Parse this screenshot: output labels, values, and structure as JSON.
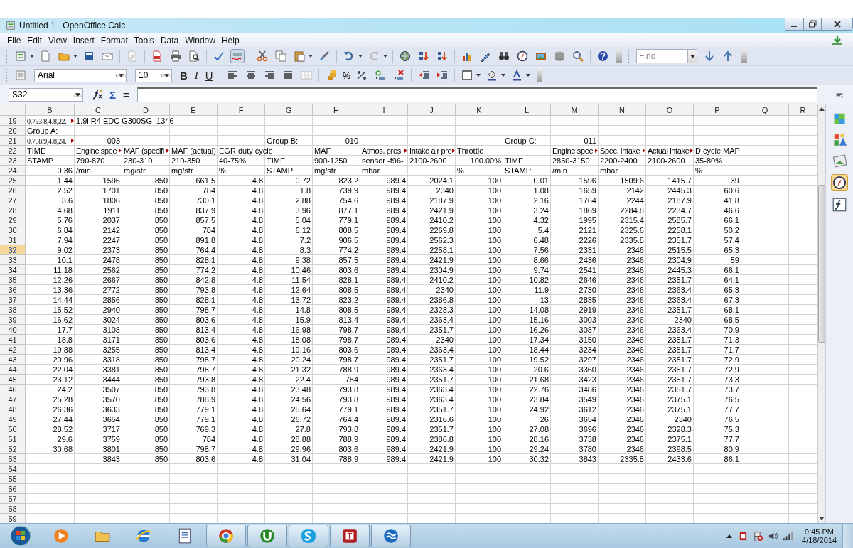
{
  "window": {
    "title": "Untitled 1 - OpenOffice Calc"
  },
  "menu": [
    "File",
    "Edit",
    "View",
    "Insert",
    "Format",
    "Tools",
    "Data",
    "Window",
    "Help"
  ],
  "find": {
    "placeholder": "Find"
  },
  "formatting": {
    "font": "Arial",
    "size": "10",
    "style_buttons": [
      "B",
      "I",
      "U"
    ],
    "percent": "%"
  },
  "formula_bar": {
    "cell_reference": "S32",
    "buttons": [
      "Σ",
      "="
    ]
  },
  "sheet": {
    "columns": [
      "B",
      "C",
      "D",
      "E",
      "F",
      "G",
      "H",
      "I",
      "J",
      "K",
      "L",
      "M",
      "N",
      "O",
      "P",
      "Q",
      "R"
    ],
    "rows": [
      {
        "number": "19",
        "selected": false,
        "cells": [
          {
            "text": "0,793.8,4.8,22.",
            "clipped": true
          },
          "1.9l R4 EDC G300SG  1346",
          null,
          null,
          null,
          null,
          null,
          null,
          null,
          null,
          null,
          null,
          null,
          null,
          null
        ]
      },
      {
        "number": "20",
        "selected": false,
        "cells": [
          "Group A:",
          null,
          null,
          null,
          null,
          null,
          null,
          null,
          null,
          null,
          null,
          null,
          null,
          null,
          null
        ]
      },
      {
        "number": "21",
        "selected": false,
        "cells": [
          {
            "text": "0,788.9,4.8,24.",
            "clipped": true
          },
          "003",
          null,
          null,
          null,
          "Group B:",
          "010",
          null,
          null,
          null,
          "Group C:",
          "011",
          null,
          null,
          null
        ]
      },
      {
        "number": "22",
        "selected": false,
        "cells": [
          "TIME",
          {
            "text": "Engine spee",
            "clipped": true
          },
          {
            "text": "MAF (specifi",
            "clipped": true
          },
          "MAF (actual)",
          "EGR duty cycle",
          null,
          "MAF",
          {
            "text": "Atmos. pres",
            "clipped": true
          },
          {
            "text": "Intake air pre",
            "clipped": true
          },
          "Throttle",
          null,
          {
            "text": "Engine spee",
            "clipped": true
          },
          {
            "text": "Spec. intake",
            "clipped": true
          },
          {
            "text": "Actual intake",
            "clipped": true
          },
          "D.cycle MAP"
        ]
      },
      {
        "number": "23",
        "selected": false,
        "cells": [
          "STAMP",
          "790-870",
          "230-310",
          "210-350",
          "40-75%",
          "TIME",
          "900-1250",
          "sensor -f96-",
          "2100-2600",
          "100.00%",
          "TIME",
          "2850-3150",
          "2200-2400",
          "2100-2600",
          "35-80%"
        ]
      },
      {
        "number": "24",
        "selected": false,
        "cells": [
          "0.36",
          "/min",
          "mg/str",
          "mg/str",
          "%",
          "STAMP",
          "mg/str",
          "mbar",
          null,
          "%",
          "STAMP",
          "/min",
          "mbar",
          null,
          "%"
        ]
      },
      {
        "number": "25",
        "selected": false,
        "cells": [
          "1.44",
          "1596",
          "850",
          "661.5",
          "4.8",
          "0.72",
          "823.2",
          "989.4",
          "2024.1",
          "100",
          "0.01",
          "1596",
          "1509.6",
          "1415.7",
          "39"
        ]
      },
      {
        "number": "26",
        "selected": false,
        "cells": [
          "2.52",
          "1701",
          "850",
          "784",
          "4.8",
          "1.8",
          "739.9",
          "989.4",
          "2340",
          "100",
          "1.08",
          "1659",
          "2142",
          "2445.3",
          "60.6"
        ]
      },
      {
        "number": "27",
        "selected": false,
        "cells": [
          "3.6",
          "1806",
          "850",
          "730.1",
          "4.8",
          "2.88",
          "754.6",
          "989.4",
          "2187.9",
          "100",
          "2.16",
          "1764",
          "2244",
          "2187.9",
          "41.8"
        ]
      },
      {
        "number": "28",
        "selected": false,
        "cells": [
          "4.68",
          "1911",
          "850",
          "837.9",
          "4.8",
          "3.96",
          "877.1",
          "989.4",
          "2421.9",
          "100",
          "3.24",
          "1869",
          "2284.8",
          "2234.7",
          "46.6"
        ]
      },
      {
        "number": "29",
        "selected": false,
        "cells": [
          "5.76",
          "2037",
          "850",
          "857.5",
          "4.8",
          "5.04",
          "779.1",
          "989.4",
          "2410.2",
          "100",
          "4.32",
          "1995",
          "2315.4",
          "2585.7",
          "66.1"
        ]
      },
      {
        "number": "30",
        "selected": false,
        "cells": [
          "6.84",
          "2142",
          "850",
          "784",
          "4.8",
          "6.12",
          "808.5",
          "989.4",
          "2269.8",
          "100",
          "5.4",
          "2121",
          "2325.6",
          "2258.1",
          "50.2"
        ]
      },
      {
        "number": "31",
        "selected": false,
        "cells": [
          "7.94",
          "2247",
          "850",
          "891.8",
          "4.8",
          "7.2",
          "906.5",
          "989.4",
          "2562.3",
          "100",
          "6.48",
          "2226",
          "2335.8",
          "2351.7",
          "57.4"
        ]
      },
      {
        "number": "32",
        "selected": true,
        "cells": [
          "9.02",
          "2373",
          "850",
          "764.4",
          "4.8",
          "8.3",
          "774.2",
          "989.4",
          "2258.1",
          "100",
          "7.56",
          "2331",
          "2346",
          "2515.5",
          "65.3"
        ]
      },
      {
        "number": "33",
        "selected": false,
        "cells": [
          "10.1",
          "2478",
          "850",
          "828.1",
          "4.8",
          "9.38",
          "857.5",
          "989.4",
          "2421.9",
          "100",
          "8.66",
          "2436",
          "2346",
          "2304.9",
          "59"
        ]
      },
      {
        "number": "34",
        "selected": false,
        "cells": [
          "11.18",
          "2562",
          "850",
          "774.2",
          "4.8",
          "10.46",
          "803.6",
          "989.4",
          "2304.9",
          "100",
          "9.74",
          "2541",
          "2346",
          "2445.3",
          "66.1"
        ]
      },
      {
        "number": "35",
        "selected": false,
        "cells": [
          "12.26",
          "2667",
          "850",
          "842.8",
          "4.8",
          "11.54",
          "828.1",
          "989.4",
          "2410.2",
          "100",
          "10.82",
          "2646",
          "2346",
          "2351.7",
          "64.1"
        ]
      },
      {
        "number": "36",
        "selected": false,
        "cells": [
          "13.36",
          "2772",
          "850",
          "793.8",
          "4.8",
          "12.64",
          "808.5",
          "989.4",
          "2340",
          "100",
          "11.9",
          "2730",
          "2346",
          "2363.4",
          "65.3"
        ]
      },
      {
        "number": "37",
        "selected": false,
        "cells": [
          "14.44",
          "2856",
          "850",
          "828.1",
          "4.8",
          "13.72",
          "823.2",
          "989.4",
          "2386.8",
          "100",
          "13",
          "2835",
          "2346",
          "2363.4",
          "67.3"
        ]
      },
      {
        "number": "38",
        "selected": false,
        "cells": [
          "15.52",
          "2940",
          "850",
          "798.7",
          "4.8",
          "14.8",
          "808.5",
          "989.4",
          "2328.3",
          "100",
          "14.08",
          "2919",
          "2346",
          "2351.7",
          "68.1"
        ]
      },
      {
        "number": "39",
        "selected": false,
        "cells": [
          "16.62",
          "3024",
          "850",
          "803.6",
          "4.8",
          "15.9",
          "813.4",
          "989.4",
          "2363.4",
          "100",
          "15.16",
          "3003",
          "2346",
          "2340",
          "68.5"
        ]
      },
      {
        "number": "40",
        "selected": false,
        "cells": [
          "17.7",
          "3108",
          "850",
          "813.4",
          "4.8",
          "16.98",
          "798.7",
          "989.4",
          "2351.7",
          "100",
          "16.26",
          "3087",
          "2346",
          "2363.4",
          "70.9"
        ]
      },
      {
        "number": "41",
        "selected": false,
        "cells": [
          "18.8",
          "3171",
          "850",
          "803.6",
          "4.8",
          "18.08",
          "798.7",
          "989.4",
          "2340",
          "100",
          "17.34",
          "3150",
          "2346",
          "2351.7",
          "71.3"
        ]
      },
      {
        "number": "42",
        "selected": false,
        "cells": [
          "19.88",
          "3255",
          "850",
          "813.4",
          "4.8",
          "19.16",
          "803.6",
          "989.4",
          "2363.4",
          "100",
          "18.44",
          "3234",
          "2346",
          "2351.7",
          "71.7"
        ]
      },
      {
        "number": "43",
        "selected": false,
        "cells": [
          "20.96",
          "3318",
          "850",
          "798.7",
          "4.8",
          "20.24",
          "798.7",
          "989.4",
          "2351.7",
          "100",
          "19.52",
          "3297",
          "2346",
          "2351.7",
          "72.9"
        ]
      },
      {
        "number": "44",
        "selected": false,
        "cells": [
          "22.04",
          "3381",
          "850",
          "798.7",
          "4.8",
          "21.32",
          "788.9",
          "989.4",
          "2363.4",
          "100",
          "20.6",
          "3360",
          "2346",
          "2351.7",
          "72.9"
        ]
      },
      {
        "number": "45",
        "selected": false,
        "cells": [
          "23.12",
          "3444",
          "850",
          "793.8",
          "4.8",
          "22.4",
          "784",
          "989.4",
          "2351.7",
          "100",
          "21.68",
          "3423",
          "2346",
          "2351.7",
          "73.3"
        ]
      },
      {
        "number": "46",
        "selected": false,
        "cells": [
          "24.2",
          "3507",
          "850",
          "793.8",
          "4.8",
          "23.48",
          "793.8",
          "989.4",
          "2363.4",
          "100",
          "22.76",
          "3486",
          "2346",
          "2351.7",
          "73.7"
        ]
      },
      {
        "number": "47",
        "selected": false,
        "cells": [
          "25.28",
          "3570",
          "850",
          "788.9",
          "4.8",
          "24.56",
          "793.8",
          "989.4",
          "2363.4",
          "100",
          "23.84",
          "3549",
          "2346",
          "2375.1",
          "76.5"
        ]
      },
      {
        "number": "48",
        "selected": false,
        "cells": [
          "26.36",
          "3633",
          "850",
          "779.1",
          "4.8",
          "25.64",
          "779.1",
          "989.4",
          "2351.7",
          "100",
          "24.92",
          "3612",
          "2346",
          "2375.1",
          "77.7"
        ]
      },
      {
        "number": "49",
        "selected": false,
        "cells": [
          "27.44",
          "3654",
          "850",
          "779.1",
          "4.8",
          "26.72",
          "764.4",
          "989.4",
          "2316.6",
          "100",
          "26",
          "3654",
          "2346",
          "2340",
          "76.5"
        ]
      },
      {
        "number": "50",
        "selected": false,
        "cells": [
          "28.52",
          "3717",
          "850",
          "769.3",
          "4.8",
          "27.8",
          "793.8",
          "989.4",
          "2351.7",
          "100",
          "27.08",
          "3696",
          "2346",
          "2328.3",
          "75.3"
        ]
      },
      {
        "number": "51",
        "selected": false,
        "cells": [
          "29.6",
          "3759",
          "850",
          "784",
          "4.8",
          "28.88",
          "788.9",
          "989.4",
          "2386.8",
          "100",
          "28.16",
          "3738",
          "2346",
          "2375.1",
          "77.7"
        ]
      },
      {
        "number": "52",
        "selected": false,
        "cells": [
          "30.68",
          "3801",
          "850",
          "798.7",
          "4.8",
          "29.96",
          "803.6",
          "989.4",
          "2421.9",
          "100",
          "29.24",
          "3780",
          "2346",
          "2398.5",
          "80.9"
        ]
      },
      {
        "number": "53",
        "selected": false,
        "cells": [
          null,
          "3843",
          "850",
          "803.6",
          "4.8",
          "31.04",
          "788.9",
          "989.4",
          "2421.9",
          "100",
          "30.32",
          "3843",
          "2335.8",
          "2433.6",
          "86.1"
        ]
      },
      {
        "number": "54",
        "selected": false
      },
      {
        "number": "55",
        "selected": false
      },
      {
        "number": "56",
        "selected": false
      },
      {
        "number": "57",
        "selected": false
      },
      {
        "number": "58",
        "selected": false
      },
      {
        "number": "59",
        "selected": false
      }
    ]
  },
  "taskbar": {
    "time": "9:45 PM",
    "date": "4/18/2014"
  }
}
